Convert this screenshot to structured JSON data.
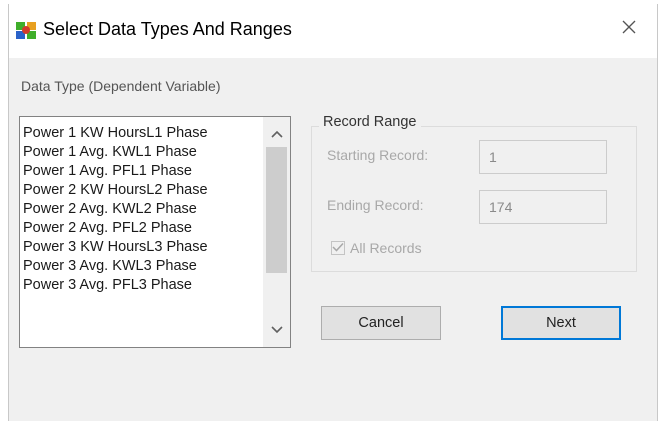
{
  "window": {
    "title": "Select Data Types And Ranges",
    "close_glyph": "✕"
  },
  "data_type": {
    "label": "Data Type (Dependent Variable)",
    "items": [
      "Power 1 KW HoursL1 Phase",
      "Power 1 Avg. KWL1 Phase",
      "Power 1 Avg. PFL1 Phase",
      "Power 2 KW HoursL2 Phase",
      "Power 2 Avg. KWL2 Phase",
      "Power 2 Avg. PFL2 Phase",
      "Power 3 KW HoursL3 Phase",
      "Power 3 Avg. KWL3 Phase",
      "Power 3 Avg. PFL3 Phase"
    ]
  },
  "record_range": {
    "title": "Record Range",
    "starting_label": "Starting Record:",
    "starting_value": "1",
    "ending_label": "Ending Record:",
    "ending_value": "174",
    "all_records_label": "All Records",
    "all_records_checked": true
  },
  "buttons": {
    "cancel": "Cancel",
    "next": "Next"
  },
  "colors": {
    "default_button_border": "#0078d7",
    "disabled_text": "#a8a8a8"
  }
}
